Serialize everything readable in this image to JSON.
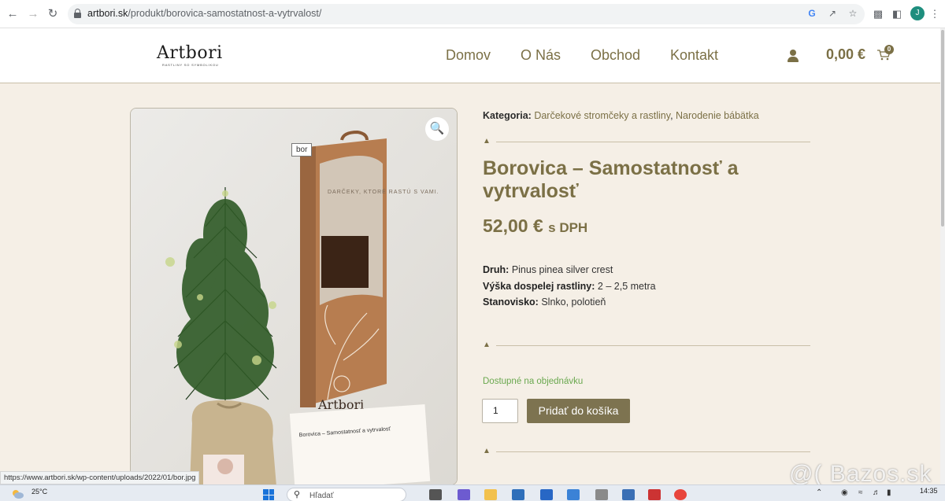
{
  "browser": {
    "back_icon": "arrow-left-icon",
    "forward_icon": "arrow-right-icon",
    "reload_icon": "reload-icon",
    "url_domain": "artbori.sk",
    "url_path": "/produkt/borovica-samostatnost-a-vytrvalost/",
    "profile_initial": "J"
  },
  "header": {
    "logo": "Artbori",
    "logo_tagline": "RASTLINY SO SYMBOLIKOU",
    "menu": [
      "Domov",
      "O Nás",
      "Obchod",
      "Kontakt"
    ],
    "cart_total": "0,00 €",
    "cart_count": "0"
  },
  "product": {
    "image_tooltip": "bor",
    "category_label": "Kategoria:",
    "categories": [
      "Darčekové stromčeky a rastliny",
      "Narodenie bábätka"
    ],
    "category_separator": ", ",
    "title": "Borovica – Samostatnosť a vytrvalosť",
    "price": "52,00 €",
    "price_suffix": "s DPH",
    "attributes": [
      {
        "label": "Druh:",
        "value": "Pinus pinea silver crest"
      },
      {
        "label": "Výška dospelej rastliny:",
        "value": "2 – 2,5 metra"
      },
      {
        "label": "Stanovisko:",
        "value": "Slnko, polotieň"
      }
    ],
    "availability": "Dostupné na objednávku",
    "quantity": "1",
    "add_to_cart": "Pridať do košíka",
    "box_text": "DARČEKY, KTORÉ RASTÚ S VAMI.",
    "card_title": "Borovica – Samostatnosť a vytrvalosť",
    "box_brand": "Artbori"
  },
  "status_bar": {
    "link": "https://www.artbori.sk/wp-content/uploads/2022/01/bor.jpg"
  },
  "watermark": "@( Bazos.sk",
  "taskbar": {
    "temperature": "25°C",
    "search_placeholder": "Hľadať",
    "time": "14:35"
  },
  "colors": {
    "accent": "#7b7046",
    "page_bg": "#f5efe6",
    "stock_green": "#6aa84f"
  }
}
